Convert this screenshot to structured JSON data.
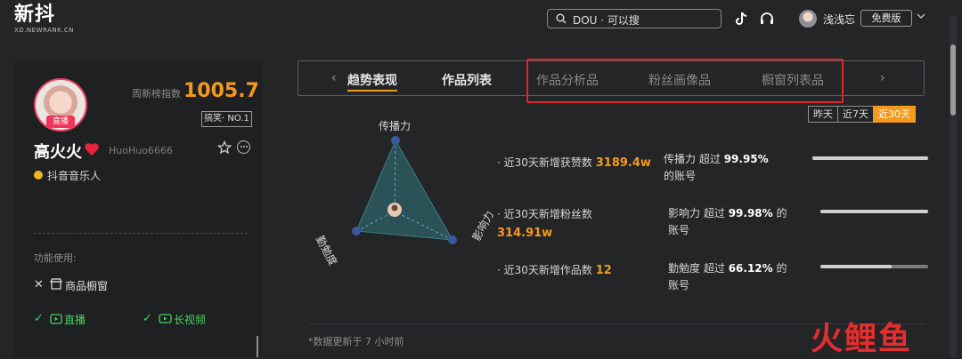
{
  "header": {
    "logo_main": "新抖",
    "logo_sub": "XD.NEWRANK.CN",
    "search_text": "DOU · 可以搜",
    "username": "浅浅忘",
    "plan": "免费版"
  },
  "profile": {
    "live_badge": "直播",
    "rank_label": "周新榜指数",
    "rank_value": "1005.7",
    "rank_tag": "搞笑· NO.1",
    "name": "高火火",
    "handle": "HuoHuo6666",
    "category": "抖音音乐人",
    "features_label": "功能使用:",
    "features": [
      {
        "mark": "✕",
        "label": "商品橱窗",
        "enabled": false
      },
      {
        "mark": "✓",
        "label": "直播",
        "enabled": true
      },
      {
        "mark": "✓",
        "label": "长视频",
        "enabled": true
      }
    ]
  },
  "tabs": {
    "items": [
      {
        "label": "趋势表现",
        "active": true
      },
      {
        "label": "作品列表",
        "active": false
      },
      {
        "label": "作品分析",
        "active": false,
        "suffix": "品"
      },
      {
        "label": "粉丝画像",
        "active": false,
        "suffix": "品"
      },
      {
        "label": "橱窗列表",
        "active": false,
        "suffix": "品"
      }
    ],
    "prev": "‹",
    "next": "›"
  },
  "range": {
    "options": [
      "昨天",
      "近7天",
      "近30天"
    ],
    "selected": "近30天"
  },
  "radar": {
    "axes": [
      "传播力",
      "勤勉度",
      "影响力"
    ]
  },
  "stats": [
    {
      "label": "近30天新增获赞数",
      "value": "3189.4w"
    },
    {
      "label": "近30天新增粉丝数",
      "value": "314.91w"
    },
    {
      "label": "近30天新增作品数",
      "value": "12"
    }
  ],
  "percentiles": [
    {
      "metric": "传播力",
      "prefix": "超过",
      "value": "99.95%",
      "suffix": "的账号",
      "fill": 0.9995
    },
    {
      "metric": "影响力",
      "prefix": "超过",
      "value": "99.98%",
      "suffix": "的账号",
      "fill": 0.9998
    },
    {
      "metric": "勤勉度",
      "prefix": "超过",
      "value": "66.12%",
      "suffix": "的账号",
      "fill": 0.6612
    }
  ],
  "footnote": "*数据更新于 7 小时前",
  "watermark": "火鲤鱼",
  "colors": {
    "accent": "#f39a1e",
    "highlight_box": "#e0262b",
    "success": "#4bd160",
    "live": "#f0355a"
  }
}
